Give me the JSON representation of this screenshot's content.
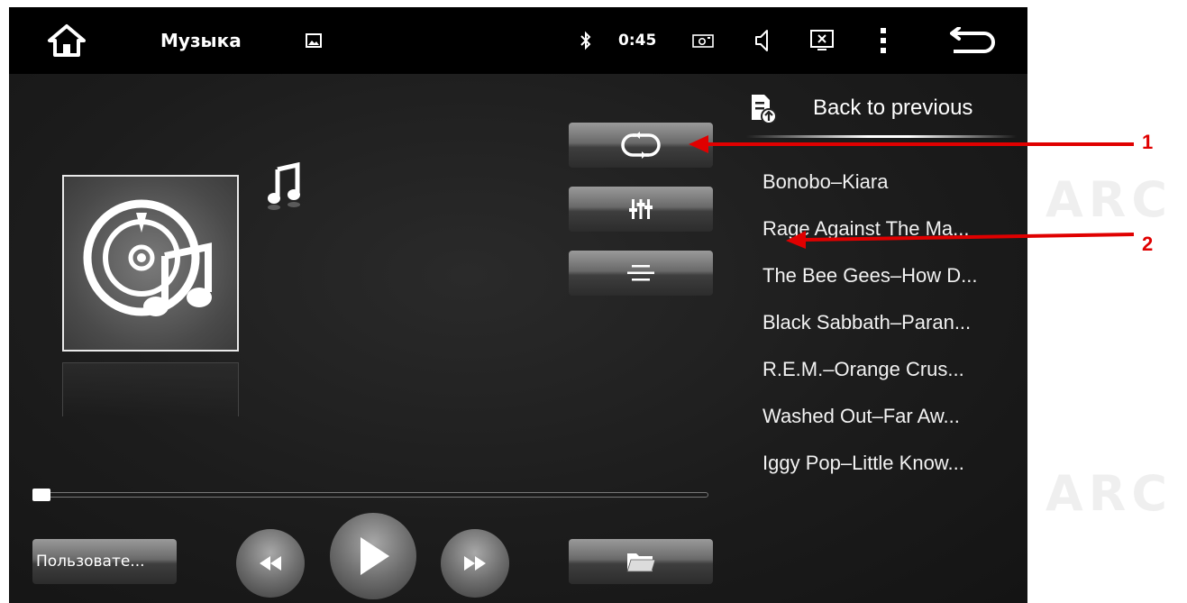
{
  "statusbar": {
    "title": "Музыка",
    "time": "0:45",
    "icons": [
      "home-icon",
      "image-icon",
      "bluetooth-icon",
      "camera-icon",
      "volume-icon",
      "close-screen-icon",
      "more-icon",
      "back-icon"
    ]
  },
  "player": {
    "progress": 0.0,
    "user_button_label": "Пользовате..."
  },
  "playlist": {
    "back_label": "Back to previous",
    "tracks": [
      "Bonobo–Kiara",
      "Rage Against The Ma...",
      "The Bee Gees–How D...",
      "Black Sabbath–Paran...",
      "R.E.M.–Orange Crus...",
      "Washed Out–Far Aw...",
      "Iggy Pop–Little Know..."
    ]
  },
  "annotations": {
    "callout_1": "1",
    "callout_2": "2",
    "color": "#e00000"
  },
  "watermark": {
    "text": "ARC"
  }
}
